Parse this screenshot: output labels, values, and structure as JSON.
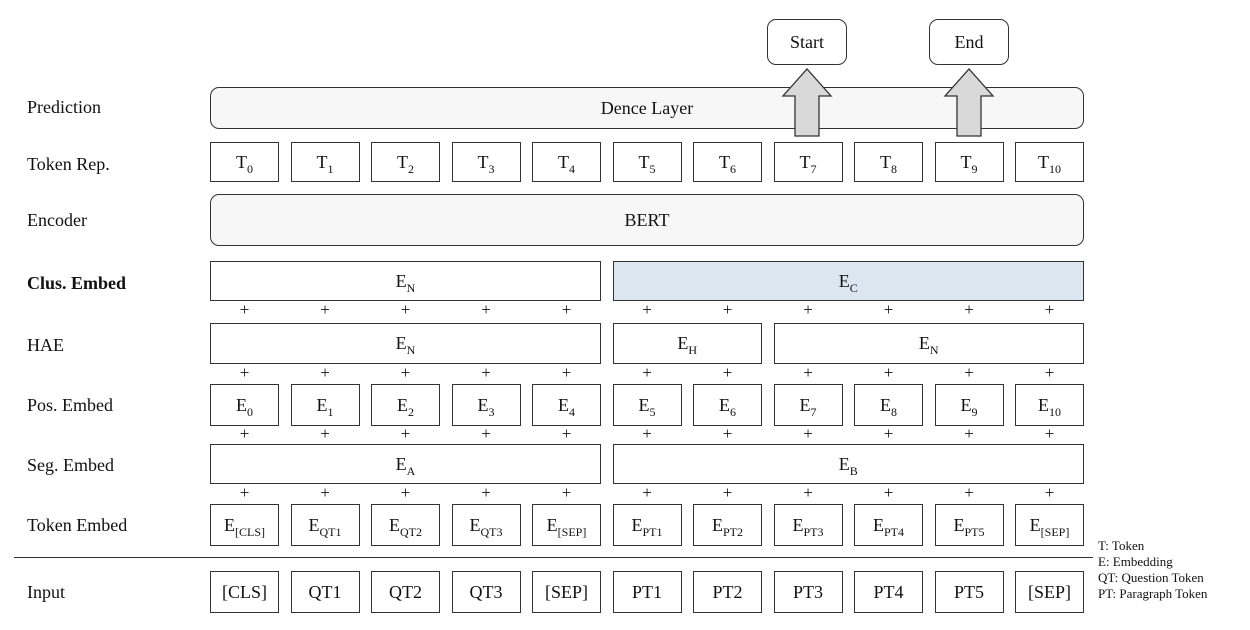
{
  "row_labels": {
    "prediction": "Prediction",
    "token_rep": "Token Rep.",
    "encoder": "Encoder",
    "clus_embed": "Clus. Embed",
    "hae": "HAE",
    "pos_embed": "Pos. Embed",
    "seg_embed": "Seg. Embed",
    "token_embed": "Token Embed",
    "input": "Input"
  },
  "outputs": {
    "start": "Start",
    "end": "End"
  },
  "dense_layer": "Dence Layer",
  "encoder_block": "BERT",
  "token_rep": [
    {
      "base": "T",
      "sub": "0"
    },
    {
      "base": "T",
      "sub": "1"
    },
    {
      "base": "T",
      "sub": "2"
    },
    {
      "base": "T",
      "sub": "3"
    },
    {
      "base": "T",
      "sub": "4"
    },
    {
      "base": "T",
      "sub": "5"
    },
    {
      "base": "T",
      "sub": "6"
    },
    {
      "base": "T",
      "sub": "7"
    },
    {
      "base": "T",
      "sub": "8"
    },
    {
      "base": "T",
      "sub": "9"
    },
    {
      "base": "T",
      "sub": "10"
    }
  ],
  "clus_embed": [
    {
      "base": "E",
      "sub": "N",
      "from": 0,
      "to": 4,
      "highlight": false
    },
    {
      "base": "E",
      "sub": "C",
      "from": 5,
      "to": 10,
      "highlight": true
    }
  ],
  "hae": [
    {
      "base": "E",
      "sub": "N",
      "from": 0,
      "to": 4
    },
    {
      "base": "E",
      "sub": "H",
      "from": 5,
      "to": 6
    },
    {
      "base": "E",
      "sub": "N",
      "from": 7,
      "to": 10
    }
  ],
  "pos_embed": [
    {
      "base": "E",
      "sub": "0"
    },
    {
      "base": "E",
      "sub": "1"
    },
    {
      "base": "E",
      "sub": "2"
    },
    {
      "base": "E",
      "sub": "3"
    },
    {
      "base": "E",
      "sub": "4"
    },
    {
      "base": "E",
      "sub": "5"
    },
    {
      "base": "E",
      "sub": "6"
    },
    {
      "base": "E",
      "sub": "7"
    },
    {
      "base": "E",
      "sub": "8"
    },
    {
      "base": "E",
      "sub": "9"
    },
    {
      "base": "E",
      "sub": "10"
    }
  ],
  "seg_embed": [
    {
      "base": "E",
      "sub": "A",
      "from": 0,
      "to": 4
    },
    {
      "base": "E",
      "sub": "B",
      "from": 5,
      "to": 10
    }
  ],
  "token_embed": [
    {
      "base": "E",
      "sub": "[CLS]"
    },
    {
      "base": "E",
      "sub": "QT1"
    },
    {
      "base": "E",
      "sub": "QT2"
    },
    {
      "base": "E",
      "sub": "QT3"
    },
    {
      "base": "E",
      "sub": "[SEP]"
    },
    {
      "base": "E",
      "sub": "PT1"
    },
    {
      "base": "E",
      "sub": "PT2"
    },
    {
      "base": "E",
      "sub": "PT3"
    },
    {
      "base": "E",
      "sub": "PT4"
    },
    {
      "base": "E",
      "sub": "PT5"
    },
    {
      "base": "E",
      "sub": "[SEP]"
    }
  ],
  "input_tokens": [
    "[CLS]",
    "QT1",
    "QT2",
    "QT3",
    "[SEP]",
    "PT1",
    "PT2",
    "PT3",
    "PT4",
    "PT5",
    "[SEP]"
  ],
  "plus_symbol": "+",
  "legend": [
    "T: Token",
    "E: Embedding",
    "QT: Question Token",
    "PT: Paragraph Token"
  ],
  "colors": {
    "highlight": "#dce6f1",
    "rounded_fill": "#f7f7f7",
    "border": "#333333"
  }
}
